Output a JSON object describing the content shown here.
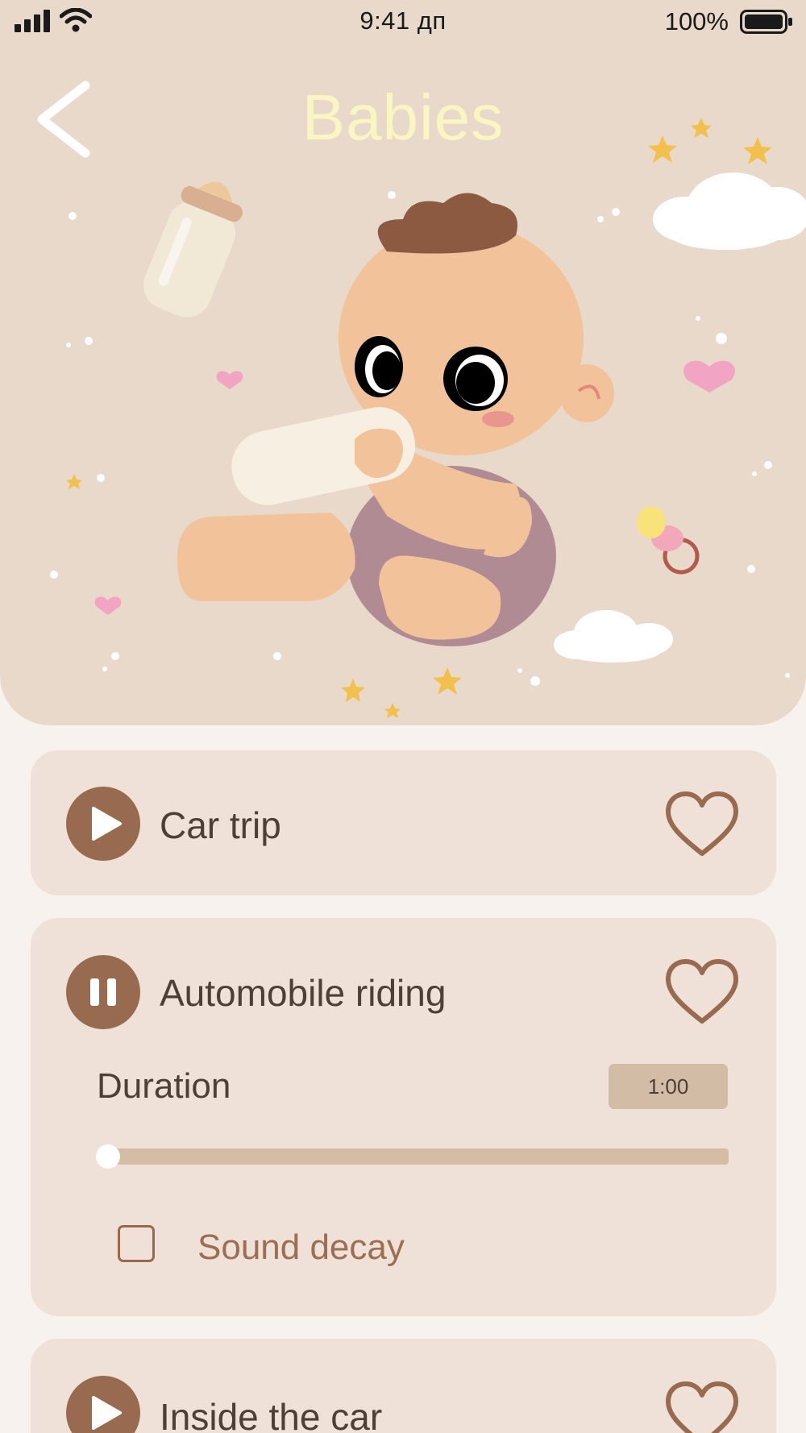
{
  "status_bar": {
    "time": "9:41 дп",
    "battery_percent": "100%"
  },
  "header": {
    "title": "Babies",
    "back_icon": "chevron-left-icon"
  },
  "colors": {
    "hero_background": "#e9d9ca",
    "title": "#fbf5c4",
    "card_background": "#efe1d8",
    "accent_brown": "#986b50",
    "text_dark": "#4d3f35",
    "slider_track": "#d4bca5",
    "duration_badge": "#d3bca6"
  },
  "tracks": [
    {
      "title": "Car trip",
      "state": "stopped",
      "control_icon": "play-icon",
      "favorite_icon": "heart-outline-icon"
    },
    {
      "title": "Automobile riding",
      "state": "playing",
      "control_icon": "pause-icon",
      "favorite_icon": "heart-outline-icon",
      "duration_label": "Duration",
      "duration_value": "1:00",
      "progress_fraction": 0.0,
      "sound_decay_label": "Sound decay",
      "sound_decay_checked": false
    },
    {
      "title": "Inside the car",
      "state": "stopped",
      "control_icon": "play-icon",
      "favorite_icon": "heart-outline-icon"
    }
  ]
}
